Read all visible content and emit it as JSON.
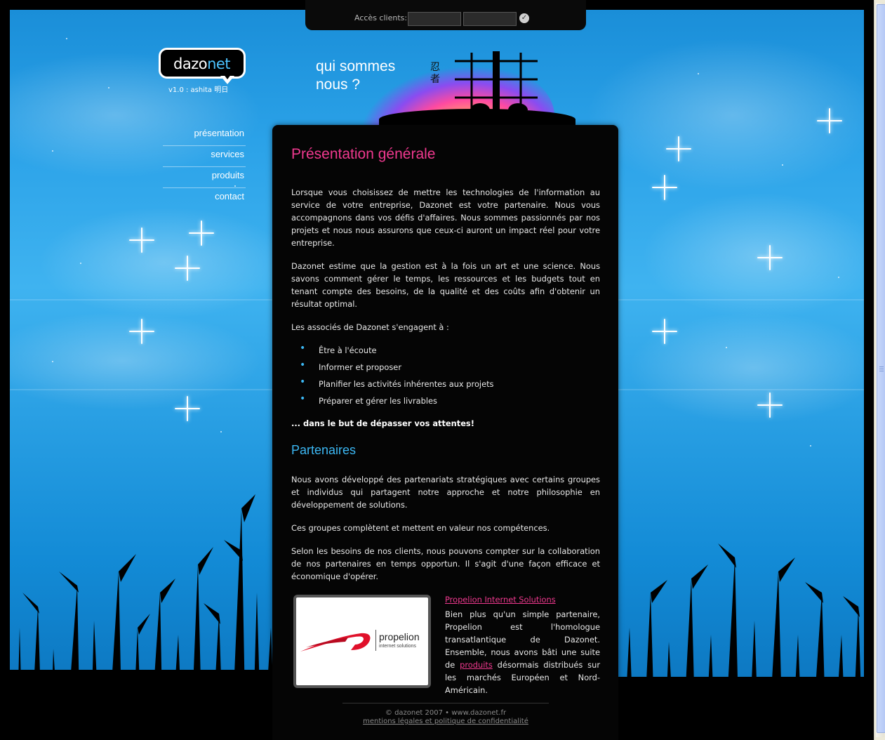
{
  "login": {
    "label": "Accès clients:",
    "username_value": "",
    "password_value": "",
    "submit_icon": "check-circle-icon"
  },
  "brand": {
    "name_part1": "dazo",
    "name_part2": "net",
    "version": "v1.0 : ashita 明日"
  },
  "nav": {
    "items": [
      {
        "label": "présentation"
      },
      {
        "label": "services"
      },
      {
        "label": "produits"
      },
      {
        "label": "contact"
      }
    ]
  },
  "header": {
    "line1": "qui sommes",
    "line2": "nous ?",
    "kanji": "忍者"
  },
  "main": {
    "title": "Présentation générale",
    "p1": "Lorsque vous choisissez de mettre les technologies de l'information au service de votre entreprise, Dazonet est votre partenaire. Nous vous accompagnons dans vos défis d'affaires. Nous sommes passionnés par nos projets et nous nous assurons que ceux-ci auront un impact réel pour votre entreprise.",
    "p2": "Dazonet estime que la gestion est à la fois un art et une science. Nous savons comment gérer le temps, les ressources et les budgets tout en tenant compte des besoins, de la qualité et des coûts afin d'obtenir un résultat optimal.",
    "p3": "Les associés de Dazonet s'engagent à :",
    "commitments": [
      "Être à l'écoute",
      "Informer et proposer",
      "Planifier les activités inhérentes aux projets",
      "Préparer et gérer les livrables"
    ],
    "tagline": "... dans le but de dépasser vos attentes!",
    "partners_title": "Partenaires",
    "p4": "Nous avons développé des partenariats stratégiques avec certains groupes et individus qui partagent notre approche et notre philosophie en développement de solutions.",
    "p5": "Ces groupes complètent et mettent en valeur nos compétences.",
    "p6": "Selon les besoins de nos clients, nous pouvons compter sur la collaboration de nos partenaires en temps opportun. Il s'agit d'une façon efficace et économique d'opérer.",
    "partner": {
      "logo_name": "propelion",
      "logo_sub": "internet solutions",
      "link": "Propelion Internet Solutions",
      "text_before": "Bien plus qu'un simple partenaire, Propelion est l'homologue transatlantique de Dazonet. Ensemble, nous avons bâti une suite de",
      "text_link": "produits",
      "text_after": "désormais distribués sur les marchés Européen et Nord-Américain."
    }
  },
  "footer": {
    "copyright": "© dazonet 2007 • www.dazonet.fr",
    "legal": "mentions légales et politique de confidentialité"
  },
  "colors": {
    "accent_pink": "#f0398f",
    "accent_blue": "#3cb8f4",
    "panel": "#050505"
  }
}
